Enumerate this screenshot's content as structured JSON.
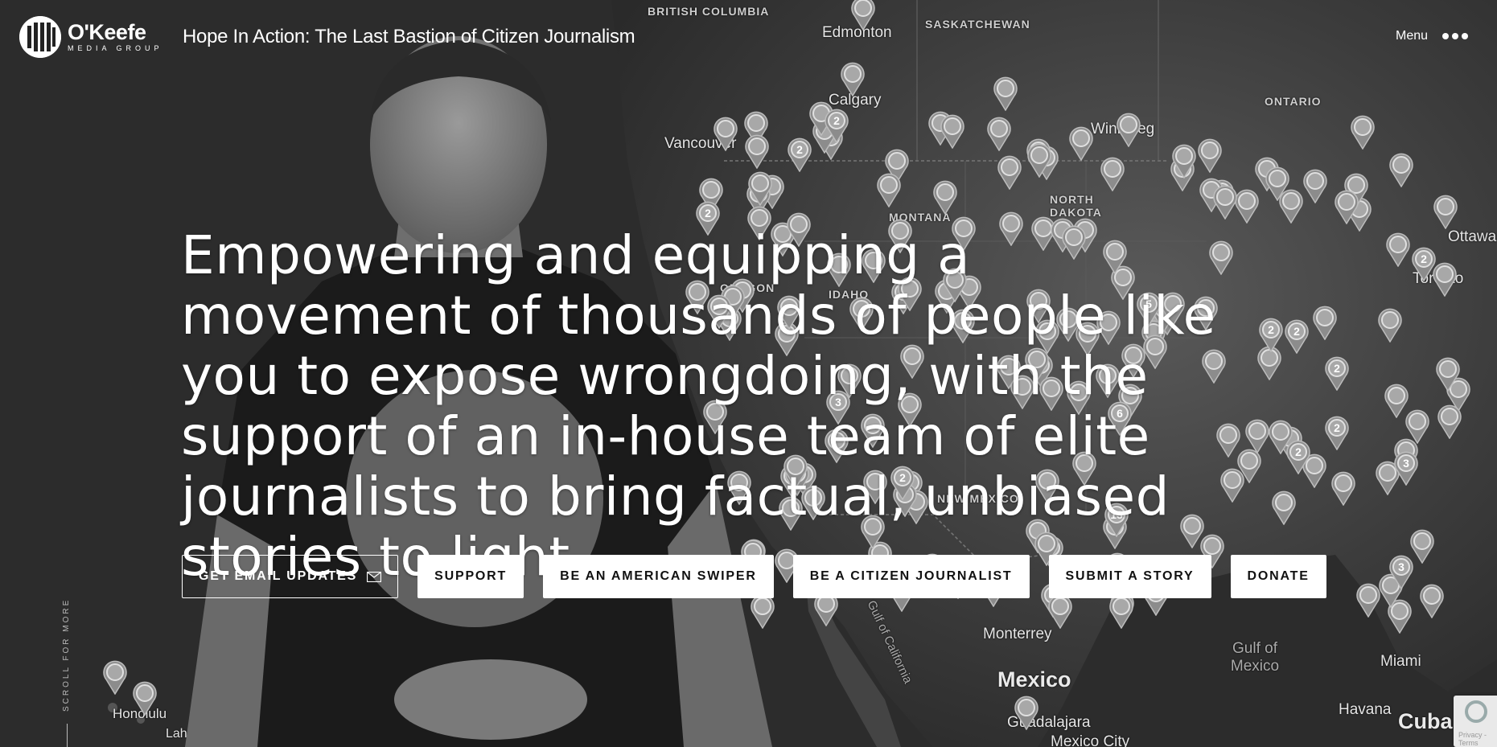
{
  "header": {
    "logo_name": "O'Keefe",
    "logo_sub": "MEDIA GROUP",
    "logo_mark_text": "OMG",
    "tagline": "Hope In Action: The Last Bastion of Citizen Journalism",
    "menu_label": "Menu"
  },
  "hero": {
    "headline": "Empowering and equipping a movement of thousands of people like you to expose wrongdoing, with the support of an in-house team of elite journalists to bring factual, unbiased stories to light."
  },
  "cta": {
    "email_updates": "GET EMAIL UPDATES",
    "support": "SUPPORT",
    "american_swiper": "BE AN AMERICAN SWIPER",
    "citizen_journalist": "BE A CITIZEN JOURNALIST",
    "submit_story": "SUBMIT A STORY",
    "donate": "DONATE"
  },
  "scroll_hint": "SCROLL FOR MORE",
  "recaptcha_label": "Privacy - Terms",
  "map": {
    "labels": {
      "british_columbia": "BRITISH COLUMBIA",
      "saskatchewan": "SASKATCHEWAN",
      "edmonton": "Edmonton",
      "calgary": "Calgary",
      "ontario": "ONTARIO",
      "winnipeg": "Winnipeg",
      "vancouver": "Vancouver",
      "north_dakota": "NORTH DAKOTA",
      "montana": "MONTANA",
      "oregon": "OREGON",
      "idaho": "IDAHO",
      "ottawa": "Ottawa",
      "toronto": "Toronto",
      "new_mexico": "NEW MEXICO",
      "monterrey": "Monterrey",
      "gulf_of_mexico": "Gulf of Mexico",
      "miami": "Miami",
      "mexico": "Mexico",
      "havana": "Havana",
      "cuba": "Cuba",
      "honolulu": "Honolulu",
      "lahaina": "Lahaina",
      "guadalajara": "Guadalajara",
      "mexico_city": "Mexico City",
      "gulf_of_california": "Gulf of California"
    },
    "marker_counts": [
      "2",
      "2",
      "2",
      "5",
      "3",
      "6",
      "2",
      "2",
      "2",
      "13",
      "2",
      "3",
      "2",
      "2",
      "3",
      "2"
    ]
  },
  "colors": {
    "background": "#2a2a2a",
    "text": "#ffffff",
    "button_bg": "#ffffff",
    "button_text": "#111111"
  }
}
